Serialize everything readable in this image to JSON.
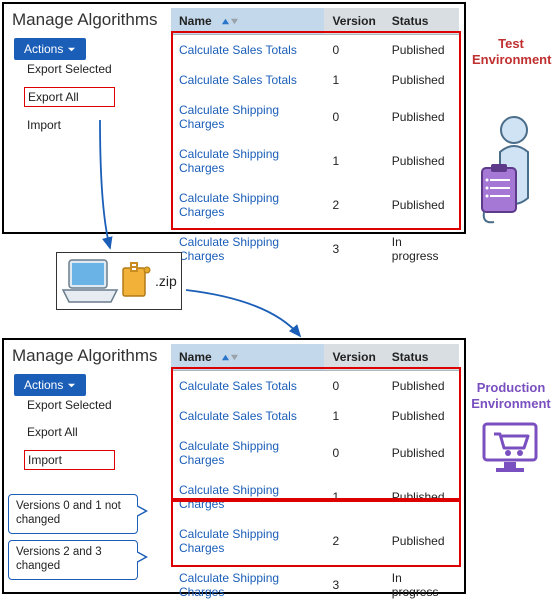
{
  "env_labels": {
    "test": "Test Environment",
    "prod": "Production Environment"
  },
  "zip": {
    "ext": ".zip"
  },
  "callouts": {
    "c1": "Versions 0 and 1 not changed",
    "c2": "Versions 2 and 3 changed"
  },
  "top": {
    "title": "Manage Algorithms",
    "actions_label": "Actions",
    "menu": {
      "export_selected": "Export Selected",
      "export_all": "Export All",
      "import": "Import"
    },
    "cols": {
      "name": "Name",
      "version": "Version",
      "status": "Status"
    },
    "rows": [
      {
        "name": "Calculate Sales Totals",
        "version": "0",
        "status": "Published"
      },
      {
        "name": "Calculate Sales Totals",
        "version": "1",
        "status": "Published"
      },
      {
        "name": "Calculate Shipping Charges",
        "version": "0",
        "status": "Published"
      },
      {
        "name": "Calculate Shipping Charges",
        "version": "1",
        "status": "Published"
      },
      {
        "name": "Calculate Shipping Charges",
        "version": "2",
        "status": "Published"
      },
      {
        "name": "Calculate Shipping Charges",
        "version": "3",
        "status": "In progress"
      }
    ]
  },
  "bottom": {
    "title": "Manage Algorithms",
    "actions_label": "Actions",
    "menu": {
      "export_selected": "Export Selected",
      "export_all": "Export All",
      "import": "Import"
    },
    "cols": {
      "name": "Name",
      "version": "Version",
      "status": "Status"
    },
    "rows": [
      {
        "name": "Calculate Sales Totals",
        "version": "0",
        "status": "Published"
      },
      {
        "name": "Calculate Sales Totals",
        "version": "1",
        "status": "Published"
      },
      {
        "name": "Calculate Shipping Charges",
        "version": "0",
        "status": "Published"
      },
      {
        "name": "Calculate Shipping Charges",
        "version": "1",
        "status": "Published"
      },
      {
        "name": "Calculate Shipping Charges",
        "version": "2",
        "status": "Published"
      },
      {
        "name": "Calculate Shipping Charges",
        "version": "3",
        "status": "In progress"
      }
    ]
  }
}
